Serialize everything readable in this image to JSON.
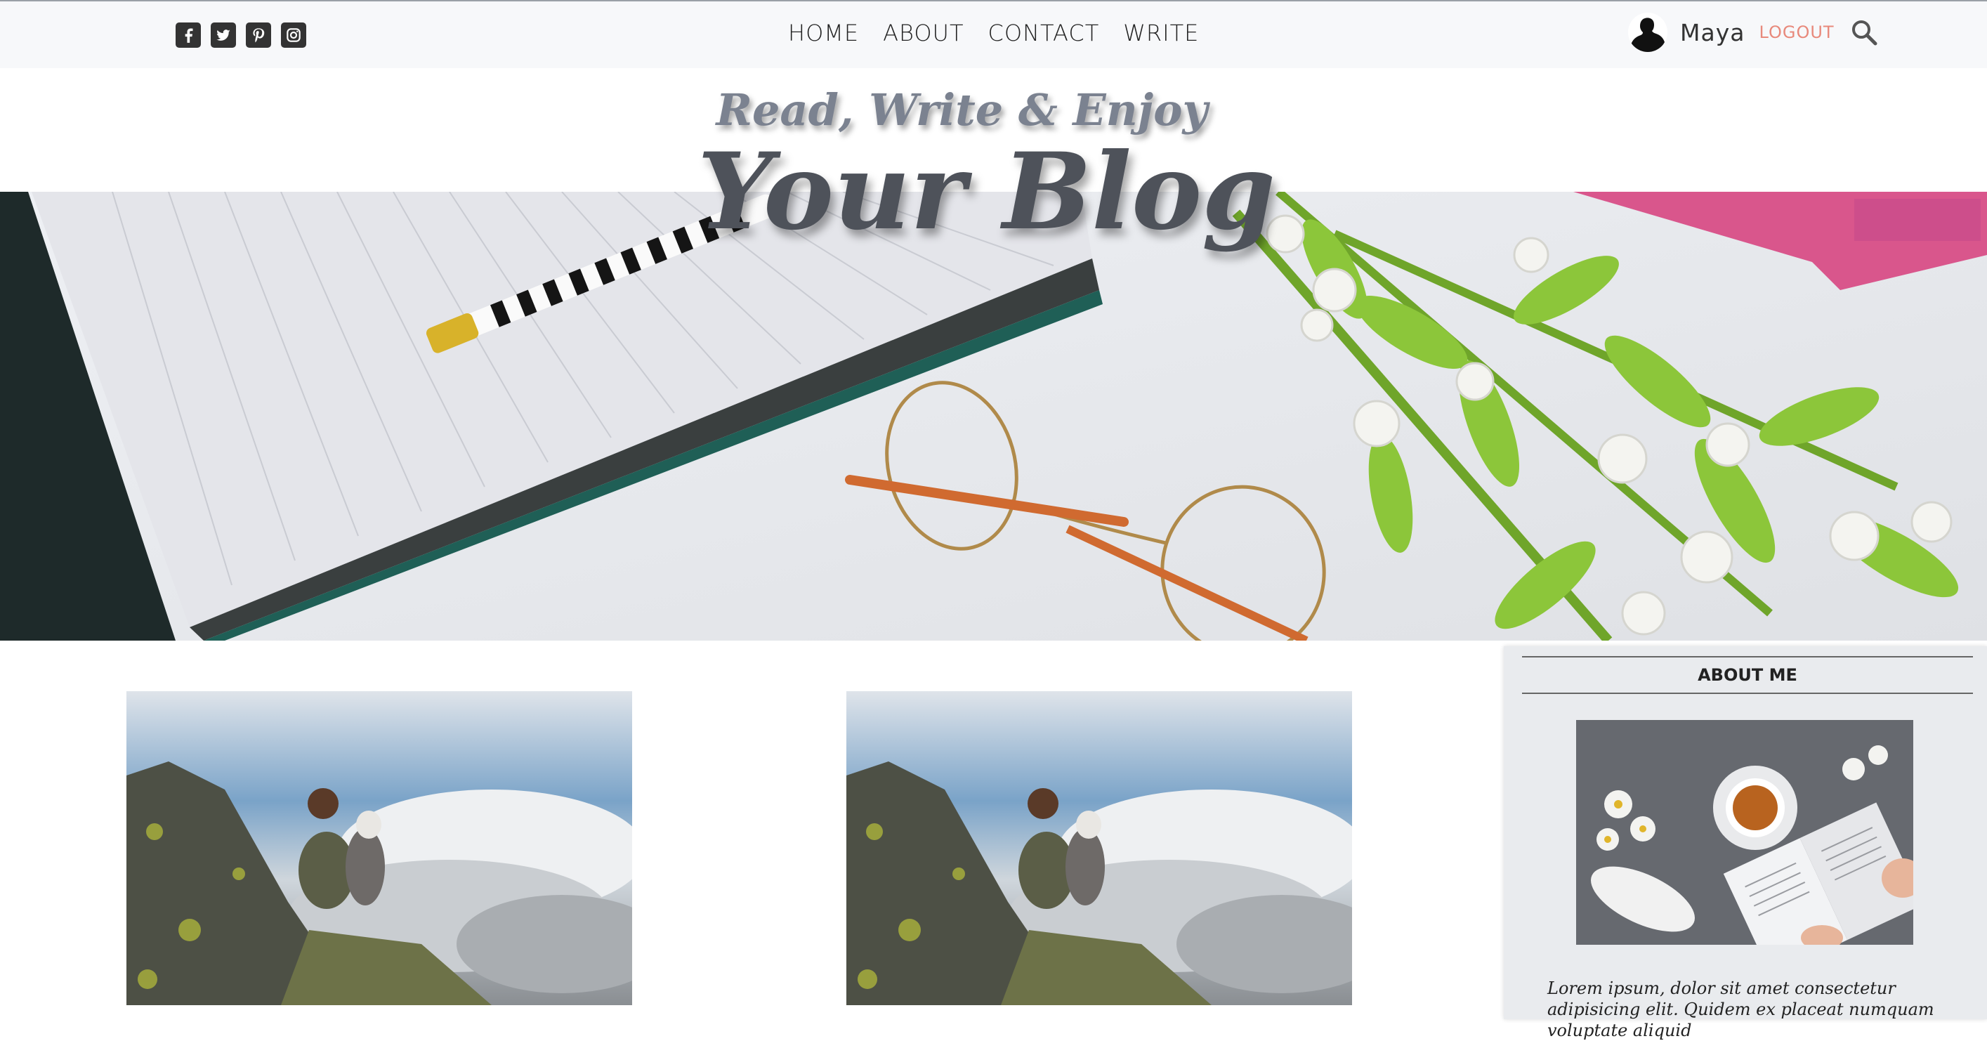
{
  "nav": {
    "social_icons": [
      "facebook-icon",
      "twitter-icon",
      "pinterest-icon",
      "instagram-icon"
    ],
    "menu": [
      "HOME",
      "ABOUT",
      "CONTACT",
      "WRITE"
    ],
    "username": "Maya",
    "logout_label": "LOGOUT",
    "accent_color": "#e8897b"
  },
  "hero": {
    "tagline": "Read, Write & Enjoy",
    "title": "Your Blog"
  },
  "sidebar": {
    "title": "ABOUT ME",
    "text": "Lorem ipsum, dolor sit amet consectetur adipisicing elit. Quidem ex placeat numquam voluptate aliquid"
  }
}
